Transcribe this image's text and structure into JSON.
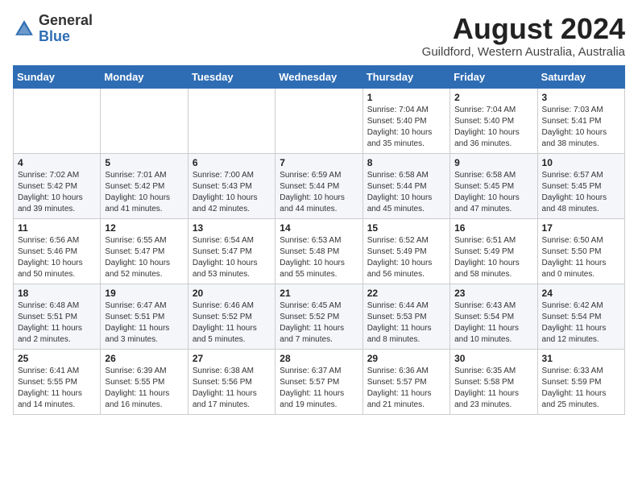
{
  "header": {
    "logo": {
      "general": "General",
      "blue": "Blue"
    },
    "title": "August 2024",
    "location": "Guildford, Western Australia, Australia"
  },
  "calendar": {
    "days_of_week": [
      "Sunday",
      "Monday",
      "Tuesday",
      "Wednesday",
      "Thursday",
      "Friday",
      "Saturday"
    ],
    "weeks": [
      [
        {
          "day": "",
          "content": ""
        },
        {
          "day": "",
          "content": ""
        },
        {
          "day": "",
          "content": ""
        },
        {
          "day": "",
          "content": ""
        },
        {
          "day": "1",
          "content": "Sunrise: 7:04 AM\nSunset: 5:40 PM\nDaylight: 10 hours\nand 35 minutes."
        },
        {
          "day": "2",
          "content": "Sunrise: 7:04 AM\nSunset: 5:40 PM\nDaylight: 10 hours\nand 36 minutes."
        },
        {
          "day": "3",
          "content": "Sunrise: 7:03 AM\nSunset: 5:41 PM\nDaylight: 10 hours\nand 38 minutes."
        }
      ],
      [
        {
          "day": "4",
          "content": "Sunrise: 7:02 AM\nSunset: 5:42 PM\nDaylight: 10 hours\nand 39 minutes."
        },
        {
          "day": "5",
          "content": "Sunrise: 7:01 AM\nSunset: 5:42 PM\nDaylight: 10 hours\nand 41 minutes."
        },
        {
          "day": "6",
          "content": "Sunrise: 7:00 AM\nSunset: 5:43 PM\nDaylight: 10 hours\nand 42 minutes."
        },
        {
          "day": "7",
          "content": "Sunrise: 6:59 AM\nSunset: 5:44 PM\nDaylight: 10 hours\nand 44 minutes."
        },
        {
          "day": "8",
          "content": "Sunrise: 6:58 AM\nSunset: 5:44 PM\nDaylight: 10 hours\nand 45 minutes."
        },
        {
          "day": "9",
          "content": "Sunrise: 6:58 AM\nSunset: 5:45 PM\nDaylight: 10 hours\nand 47 minutes."
        },
        {
          "day": "10",
          "content": "Sunrise: 6:57 AM\nSunset: 5:45 PM\nDaylight: 10 hours\nand 48 minutes."
        }
      ],
      [
        {
          "day": "11",
          "content": "Sunrise: 6:56 AM\nSunset: 5:46 PM\nDaylight: 10 hours\nand 50 minutes."
        },
        {
          "day": "12",
          "content": "Sunrise: 6:55 AM\nSunset: 5:47 PM\nDaylight: 10 hours\nand 52 minutes."
        },
        {
          "day": "13",
          "content": "Sunrise: 6:54 AM\nSunset: 5:47 PM\nDaylight: 10 hours\nand 53 minutes."
        },
        {
          "day": "14",
          "content": "Sunrise: 6:53 AM\nSunset: 5:48 PM\nDaylight: 10 hours\nand 55 minutes."
        },
        {
          "day": "15",
          "content": "Sunrise: 6:52 AM\nSunset: 5:49 PM\nDaylight: 10 hours\nand 56 minutes."
        },
        {
          "day": "16",
          "content": "Sunrise: 6:51 AM\nSunset: 5:49 PM\nDaylight: 10 hours\nand 58 minutes."
        },
        {
          "day": "17",
          "content": "Sunrise: 6:50 AM\nSunset: 5:50 PM\nDaylight: 11 hours\nand 0 minutes."
        }
      ],
      [
        {
          "day": "18",
          "content": "Sunrise: 6:48 AM\nSunset: 5:51 PM\nDaylight: 11 hours\nand 2 minutes."
        },
        {
          "day": "19",
          "content": "Sunrise: 6:47 AM\nSunset: 5:51 PM\nDaylight: 11 hours\nand 3 minutes."
        },
        {
          "day": "20",
          "content": "Sunrise: 6:46 AM\nSunset: 5:52 PM\nDaylight: 11 hours\nand 5 minutes."
        },
        {
          "day": "21",
          "content": "Sunrise: 6:45 AM\nSunset: 5:52 PM\nDaylight: 11 hours\nand 7 minutes."
        },
        {
          "day": "22",
          "content": "Sunrise: 6:44 AM\nSunset: 5:53 PM\nDaylight: 11 hours\nand 8 minutes."
        },
        {
          "day": "23",
          "content": "Sunrise: 6:43 AM\nSunset: 5:54 PM\nDaylight: 11 hours\nand 10 minutes."
        },
        {
          "day": "24",
          "content": "Sunrise: 6:42 AM\nSunset: 5:54 PM\nDaylight: 11 hours\nand 12 minutes."
        }
      ],
      [
        {
          "day": "25",
          "content": "Sunrise: 6:41 AM\nSunset: 5:55 PM\nDaylight: 11 hours\nand 14 minutes."
        },
        {
          "day": "26",
          "content": "Sunrise: 6:39 AM\nSunset: 5:55 PM\nDaylight: 11 hours\nand 16 minutes."
        },
        {
          "day": "27",
          "content": "Sunrise: 6:38 AM\nSunset: 5:56 PM\nDaylight: 11 hours\nand 17 minutes."
        },
        {
          "day": "28",
          "content": "Sunrise: 6:37 AM\nSunset: 5:57 PM\nDaylight: 11 hours\nand 19 minutes."
        },
        {
          "day": "29",
          "content": "Sunrise: 6:36 AM\nSunset: 5:57 PM\nDaylight: 11 hours\nand 21 minutes."
        },
        {
          "day": "30",
          "content": "Sunrise: 6:35 AM\nSunset: 5:58 PM\nDaylight: 11 hours\nand 23 minutes."
        },
        {
          "day": "31",
          "content": "Sunrise: 6:33 AM\nSunset: 5:59 PM\nDaylight: 11 hours\nand 25 minutes."
        }
      ]
    ]
  }
}
